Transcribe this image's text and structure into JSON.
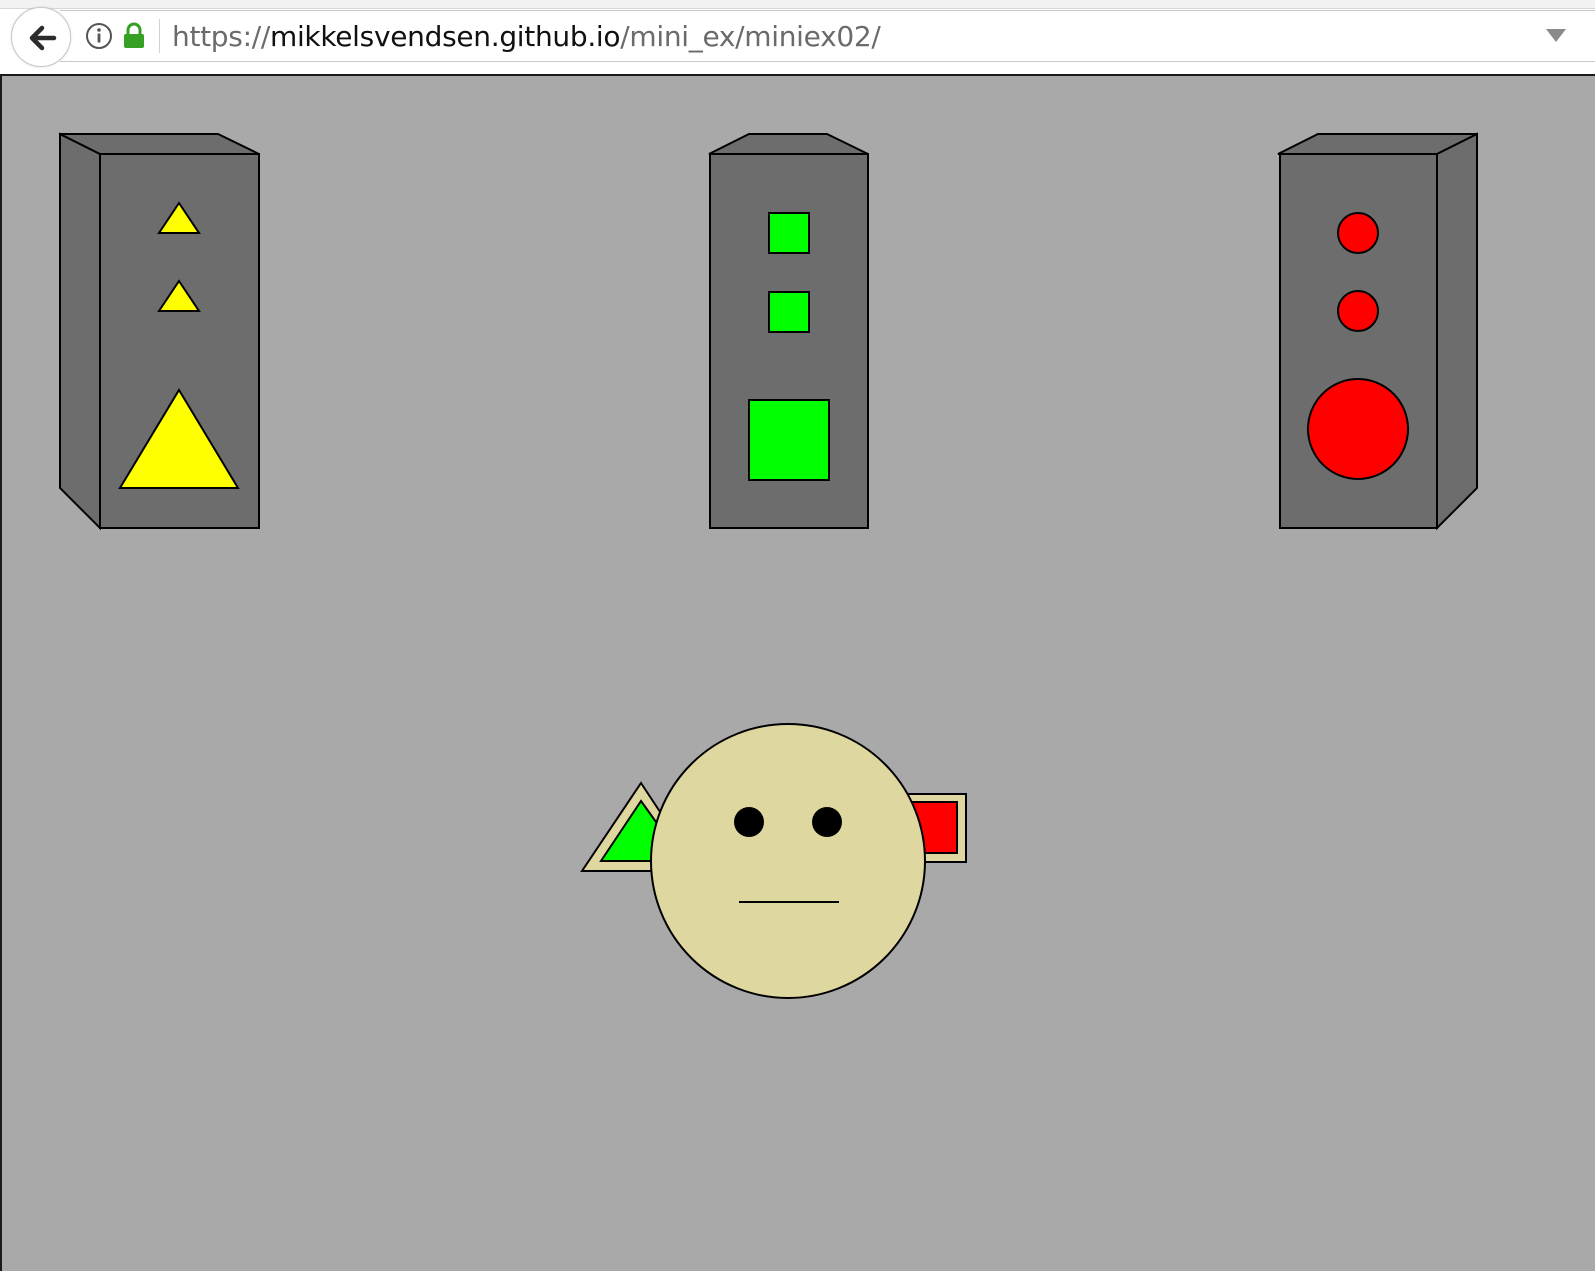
{
  "browser": {
    "url_scheme": "https://",
    "url_host": "mikkelsvendsen.github.io",
    "url_path": "/mini_ex/miniex02/",
    "icons": {
      "back": "back-arrow-icon",
      "info": "info-icon",
      "lock": "lock-icon",
      "dropdown": "dropdown-arrow-icon"
    },
    "colors": {
      "lock": "#35a023",
      "toolbar": "#ffffff"
    }
  },
  "canvas": {
    "colors": {
      "background": "#a9a9a9",
      "tower_front": "#6d6d6d",
      "tower_outline": "#000000",
      "yellow": "#ffff00",
      "green": "#00ff00",
      "red": "#ff0000",
      "face": "#ded79f",
      "eyes": "#000000"
    },
    "towers": [
      {
        "shape": "triangle",
        "color": "yellow",
        "lights": [
          "small",
          "small",
          "large"
        ],
        "side": "left"
      },
      {
        "shape": "square",
        "color": "green",
        "lights": [
          "small",
          "small",
          "large"
        ],
        "side": "none"
      },
      {
        "shape": "circle",
        "color": "red",
        "lights": [
          "small",
          "small",
          "large"
        ],
        "side": "right"
      }
    ],
    "character": {
      "expression": "neutral",
      "left_hand": "green triangle",
      "right_hand": "red square"
    }
  }
}
